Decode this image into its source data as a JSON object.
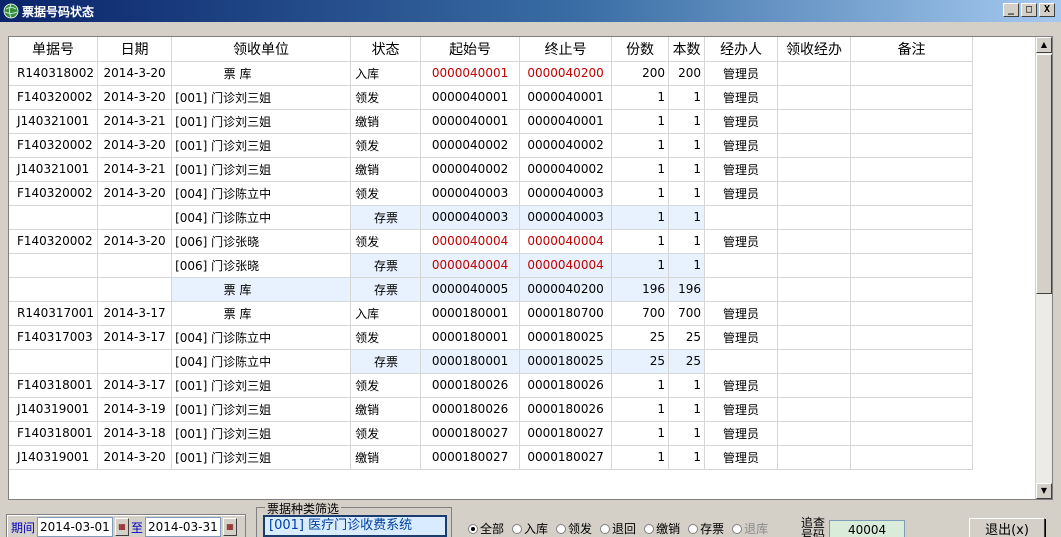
{
  "window": {
    "title": "票据号码状态",
    "min_label": "_",
    "max_label": "□",
    "close_label": "X"
  },
  "table": {
    "columns": [
      "单据号",
      "日期",
      "领收单位",
      "状态",
      "起始号",
      "终止号",
      "份数",
      "本数",
      "经办人",
      "领收经办",
      "备注"
    ],
    "rows": [
      {
        "ticket": "R140318002",
        "date": "2014-3-20",
        "unit": "票  库",
        "status": "入库",
        "start": "0000040001",
        "end": "0000040200",
        "copies": "200",
        "books": "200",
        "operator": "管理员",
        "receiver": "",
        "note": "",
        "red": true,
        "stock": false,
        "unit_center": true
      },
      {
        "ticket": "F140320002",
        "date": "2014-3-20",
        "unit": "[001] 门诊刘三姐",
        "status": "领发",
        "start": "0000040001",
        "end": "0000040001",
        "copies": "1",
        "books": "1",
        "operator": "管理员",
        "receiver": "",
        "note": "",
        "red": false,
        "stock": false
      },
      {
        "ticket": "J140321001",
        "date": "2014-3-21",
        "unit": "[001] 门诊刘三姐",
        "status": "缴销",
        "start": "0000040001",
        "end": "0000040001",
        "copies": "1",
        "books": "1",
        "operator": "管理员",
        "receiver": "",
        "note": "",
        "red": false,
        "stock": false
      },
      {
        "ticket": "F140320002",
        "date": "2014-3-20",
        "unit": "[001] 门诊刘三姐",
        "status": "领发",
        "start": "0000040002",
        "end": "0000040002",
        "copies": "1",
        "books": "1",
        "operator": "管理员",
        "receiver": "",
        "note": "",
        "red": false,
        "stock": false
      },
      {
        "ticket": "J140321001",
        "date": "2014-3-21",
        "unit": "[001] 门诊刘三姐",
        "status": "缴销",
        "start": "0000040002",
        "end": "0000040002",
        "copies": "1",
        "books": "1",
        "operator": "管理员",
        "receiver": "",
        "note": "",
        "red": false,
        "stock": false
      },
      {
        "ticket": "F140320002",
        "date": "2014-3-20",
        "unit": "[004] 门诊陈立中",
        "status": "领发",
        "start": "0000040003",
        "end": "0000040003",
        "copies": "1",
        "books": "1",
        "operator": "管理员",
        "receiver": "",
        "note": "",
        "red": false,
        "stock": false
      },
      {
        "ticket": "",
        "date": "",
        "unit": "[004] 门诊陈立中",
        "status": "存票",
        "start": "0000040003",
        "end": "0000040003",
        "copies": "1",
        "books": "1",
        "operator": "",
        "receiver": "",
        "note": "",
        "red": false,
        "stock": true
      },
      {
        "ticket": "F140320002",
        "date": "2014-3-20",
        "unit": "[006] 门诊张晓",
        "status": "领发",
        "start": "0000040004",
        "end": "0000040004",
        "copies": "1",
        "books": "1",
        "operator": "管理员",
        "receiver": "",
        "note": "",
        "red": true,
        "stock": false
      },
      {
        "ticket": "",
        "date": "",
        "unit": "[006] 门诊张晓",
        "status": "存票",
        "start": "0000040004",
        "end": "0000040004",
        "copies": "1",
        "books": "1",
        "operator": "",
        "receiver": "",
        "note": "",
        "red": true,
        "stock": true
      },
      {
        "ticket": "",
        "date": "",
        "unit": "票  库",
        "status": "存票",
        "start": "0000040005",
        "end": "0000040200",
        "copies": "196",
        "books": "196",
        "operator": "",
        "receiver": "",
        "note": "",
        "red": false,
        "stock": true,
        "unit_center": true,
        "unit_stock": true
      },
      {
        "ticket": "R140317001",
        "date": "2014-3-17",
        "unit": "票  库",
        "status": "入库",
        "start": "0000180001",
        "end": "0000180700",
        "copies": "700",
        "books": "700",
        "operator": "管理员",
        "receiver": "",
        "note": "",
        "red": false,
        "stock": false,
        "unit_center": true
      },
      {
        "ticket": "F140317003",
        "date": "2014-3-17",
        "unit": "[004] 门诊陈立中",
        "status": "领发",
        "start": "0000180001",
        "end": "0000180025",
        "copies": "25",
        "books": "25",
        "operator": "管理员",
        "receiver": "",
        "note": "",
        "red": false,
        "stock": false
      },
      {
        "ticket": "",
        "date": "",
        "unit": "[004] 门诊陈立中",
        "status": "存票",
        "start": "0000180001",
        "end": "0000180025",
        "copies": "25",
        "books": "25",
        "operator": "",
        "receiver": "",
        "note": "",
        "red": false,
        "stock": true
      },
      {
        "ticket": "F140318001",
        "date": "2014-3-17",
        "unit": "[001] 门诊刘三姐",
        "status": "领发",
        "start": "0000180026",
        "end": "0000180026",
        "copies": "1",
        "books": "1",
        "operator": "管理员",
        "receiver": "",
        "note": "",
        "red": false,
        "stock": false
      },
      {
        "ticket": "J140319001",
        "date": "2014-3-19",
        "unit": "[001] 门诊刘三姐",
        "status": "缴销",
        "start": "0000180026",
        "end": "0000180026",
        "copies": "1",
        "books": "1",
        "operator": "管理员",
        "receiver": "",
        "note": "",
        "red": false,
        "stock": false
      },
      {
        "ticket": "F140318001",
        "date": "2014-3-18",
        "unit": "[001] 门诊刘三姐",
        "status": "领发",
        "start": "0000180027",
        "end": "0000180027",
        "copies": "1",
        "books": "1",
        "operator": "管理员",
        "receiver": "",
        "note": "",
        "red": false,
        "stock": false
      },
      {
        "ticket": "J140319001",
        "date": "2014-3-20",
        "unit": "[001] 门诊刘三姐",
        "status": "缴销",
        "start": "0000180027",
        "end": "0000180027",
        "copies": "1",
        "books": "1",
        "operator": "管理员",
        "receiver": "",
        "note": "",
        "red": false,
        "stock": false
      }
    ]
  },
  "period": {
    "label": "期间",
    "from": "2014-03-01",
    "to_label": "至",
    "to": "2014-03-31"
  },
  "type_filter": {
    "legend": "票据种类筛选",
    "value": "[001] 医疗门诊收费系统"
  },
  "status_filter": {
    "options": [
      {
        "label": "全部",
        "checked": true,
        "disabled": false
      },
      {
        "label": "入库",
        "checked": false,
        "disabled": false
      },
      {
        "label": "领发",
        "checked": false,
        "disabled": false
      },
      {
        "label": "退回",
        "checked": false,
        "disabled": false
      },
      {
        "label": "缴销",
        "checked": false,
        "disabled": false
      },
      {
        "label": "存票",
        "checked": false,
        "disabled": false
      },
      {
        "label": "退库",
        "checked": false,
        "disabled": true
      }
    ]
  },
  "trace": {
    "label": "追查号码",
    "value": "40004"
  },
  "exit_button": {
    "label": "退出(x)"
  },
  "colors": {
    "title_start": "#0a246a",
    "red_serial": "#c00000",
    "stock_row": "#e8f2fe",
    "frame": "#d4d0c8"
  }
}
